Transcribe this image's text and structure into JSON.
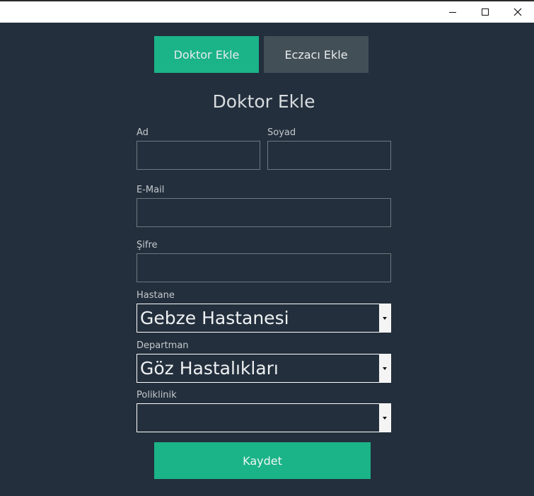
{
  "window": {
    "controls": [
      "minimize-icon",
      "maximize-icon",
      "close-icon"
    ]
  },
  "tabs": [
    {
      "label": "Doktor Ekle",
      "active": true
    },
    {
      "label": "Eczacı Ekle",
      "active": false
    }
  ],
  "form": {
    "title": "Doktor Ekle",
    "fields": {
      "ad": {
        "label": "Ad",
        "value": ""
      },
      "soyad": {
        "label": "Soyad",
        "value": ""
      },
      "email": {
        "label": "E-Mail",
        "value": ""
      },
      "sifre": {
        "label": "Şifre",
        "value": ""
      }
    },
    "selects": {
      "hastane": {
        "label": "Hastane",
        "value": "Gebze Hastanesi"
      },
      "departman": {
        "label": "Departman",
        "value": "Göz Hastalıkları"
      },
      "poliklinik": {
        "label": "Poliklinik",
        "value": ""
      }
    },
    "save_label": "Kaydet"
  },
  "colors": {
    "background": "#232f3c",
    "accent": "#1bb388",
    "inactive_tab": "#434f57"
  }
}
